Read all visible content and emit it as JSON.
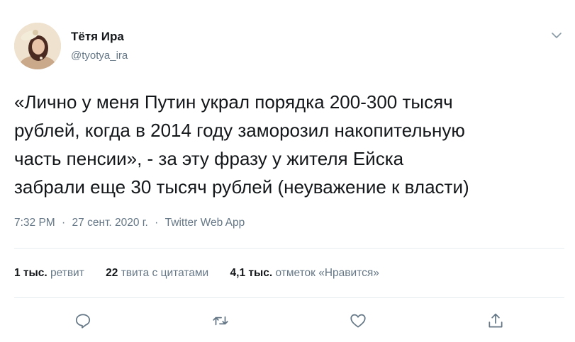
{
  "author": {
    "name": "Тётя Ира",
    "handle": "@tyotya_ira"
  },
  "tweet": {
    "lines": [
      "«Лично у меня Путин украл порядка 200-300 тысяч",
      "рублей, когда в 2014 году заморозил накопительную",
      "часть пенсии»,  - за эту фразу у жителя Ейска",
      "забрали еще 30 тысяч рублей (неуважение к власти)"
    ]
  },
  "meta": {
    "time": "7:32 PM",
    "date": "27 сент. 2020 г.",
    "source": "Twitter Web App",
    "separator": "·"
  },
  "stats": {
    "retweets": {
      "num": "1 тыс.",
      "label": "ретвит"
    },
    "quotes": {
      "num": "22",
      "label": "твита с цитатами"
    },
    "likes": {
      "num": "4,1 тыс.",
      "label": "отметок «Нравится»"
    }
  },
  "icons": {
    "caret": "chevron-down-icon",
    "reply": "reply-icon",
    "retweet": "retweet-icon",
    "like": "like-icon",
    "share": "share-icon"
  },
  "colors": {
    "text": "#14171a",
    "secondary": "#657786",
    "divider": "#e6ecf0"
  }
}
